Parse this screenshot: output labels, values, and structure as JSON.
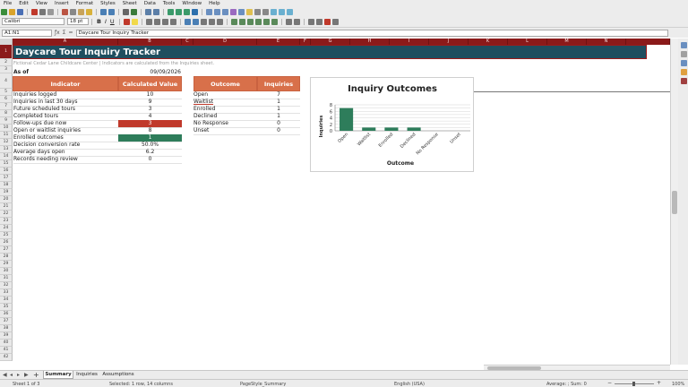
{
  "menu": [
    "File",
    "Edit",
    "View",
    "Insert",
    "Format",
    "Styles",
    "Sheet",
    "Data",
    "Tools",
    "Window",
    "Help"
  ],
  "toolbar": {
    "font_name": "Calibri",
    "font_size": "18 pt",
    "bold": "B",
    "italic": "I",
    "underline": "U"
  },
  "formula_bar": {
    "name_box": "A1:N1",
    "content": "Daycare Tour Inquiry Tracker"
  },
  "columns": [
    "A",
    "B",
    "C",
    "D",
    "E",
    "F",
    "G",
    "H",
    "I",
    "J",
    "K",
    "L",
    "M",
    "N"
  ],
  "rows": [
    "1",
    "2",
    "3",
    "4",
    "5",
    "6",
    "7",
    "8",
    "9",
    "10",
    "11",
    "12",
    "13",
    "14",
    "15",
    "16",
    "17",
    "18",
    "19",
    "20",
    "21",
    "22",
    "23",
    "24",
    "25",
    "26",
    "27",
    "28",
    "29",
    "30",
    "31",
    "32",
    "33",
    "34",
    "35",
    "36",
    "37",
    "38",
    "39",
    "40",
    "41",
    "42"
  ],
  "sheet": {
    "title": "Daycare Tour Inquiry Tracker",
    "subtitle": "Fictional Cedar Lane Childcare Center | Indicators are calculated from the Inquiries sheet.",
    "as_of_label": "As of",
    "as_of_value": "09/09/2026",
    "indicator_header": "Indicator",
    "value_header": "Calculated Value",
    "indicators": [
      {
        "label": "Inquiries logged",
        "value": "10"
      },
      {
        "label": "Inquiries in last 30 days",
        "value": "9"
      },
      {
        "label": "Future scheduled tours",
        "value": "3"
      },
      {
        "label": "Completed tours",
        "value": "4"
      },
      {
        "label": "Follow-ups due now",
        "value": "3"
      },
      {
        "label": "Open or waitlist inquiries",
        "value": "8"
      },
      {
        "label": "Enrolled outcomes",
        "value": "1"
      },
      {
        "label": "Decision conversion rate",
        "value": "50.0%"
      },
      {
        "label": "Average days open",
        "value": "6.2"
      },
      {
        "label": "Records needing review",
        "value": "0"
      }
    ],
    "outcome_header": "Outcome",
    "inquiries_header": "Inquiries",
    "outcomes": [
      {
        "label": "Open",
        "value": "7"
      },
      {
        "label": "Waitlist",
        "value": "1"
      },
      {
        "label": "Enrolled",
        "value": "1"
      },
      {
        "label": "Declined",
        "value": "1"
      },
      {
        "label": "No Response",
        "value": "0"
      },
      {
        "label": "Unset",
        "value": "0"
      }
    ]
  },
  "colors": {
    "title_bg": "#1f4e5f",
    "header_orange": "#d8704a",
    "alert_red": "#c0392b",
    "good_green": "#2e7d5b",
    "bar_green": "#2e7d5b"
  },
  "chart_data": {
    "type": "bar",
    "title": "Inquiry Outcomes",
    "xlabel": "Outcome",
    "ylabel": "Inquiries",
    "categories": [
      "Open",
      "Waitlist",
      "Enrolled",
      "Declined",
      "No Response",
      "Unset"
    ],
    "values": [
      7,
      1,
      1,
      1,
      0,
      0
    ],
    "ylim": [
      0,
      8
    ],
    "yticks": [
      "0",
      "2",
      "4",
      "6",
      "8"
    ],
    "grid": true
  },
  "sheet_tabs": [
    "Summary",
    "Inquiries",
    "Assumptions"
  ],
  "status": {
    "sheet": "Sheet 1 of 3",
    "selection": "Selected: 1 row, 14 columns",
    "page_style": "PageStyle_Summary",
    "language": "English (USA)",
    "stats": "Average: ; Sum: 0",
    "zoom": "100%"
  }
}
